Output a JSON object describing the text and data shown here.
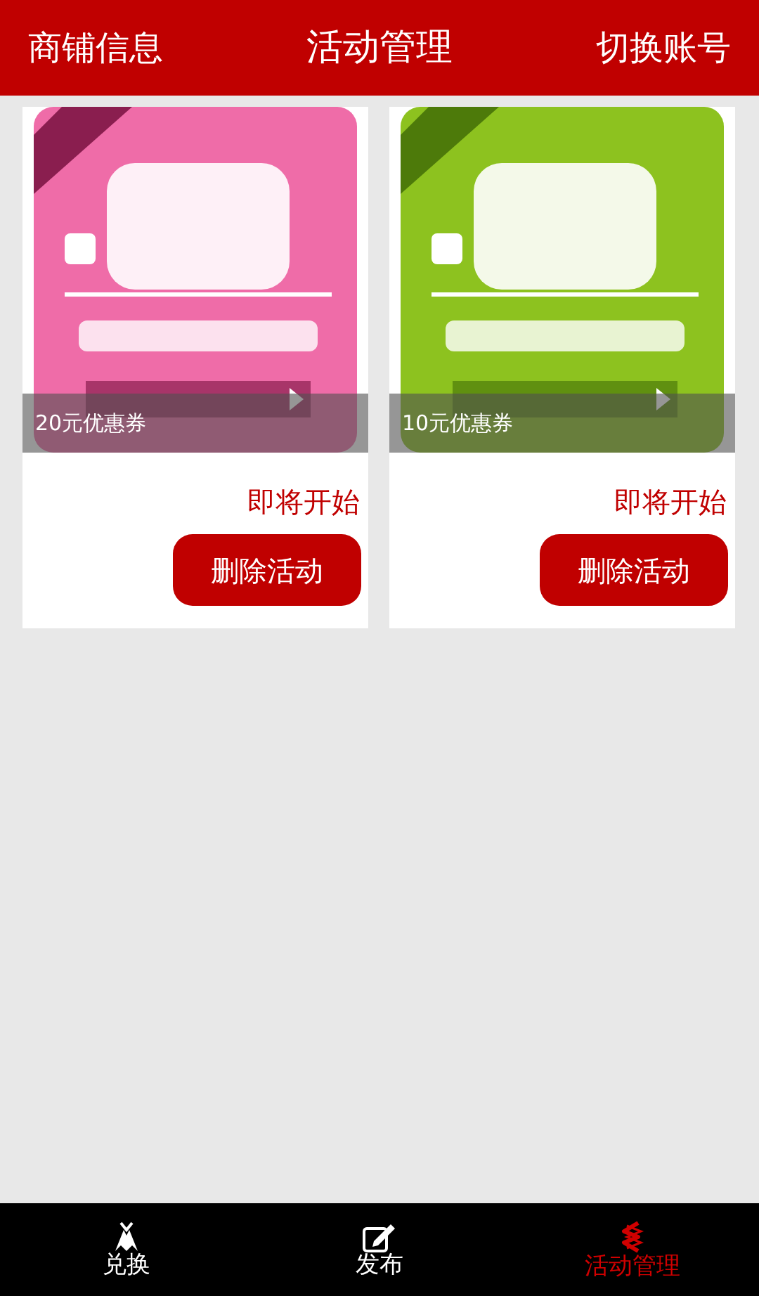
{
  "header": {
    "left": "商铺信息",
    "title": "活动管理",
    "right": "切换账号"
  },
  "activities": [
    {
      "caption": "20元优惠券",
      "status": "即将开始",
      "button": "删除活动"
    },
    {
      "caption": "10元优惠券",
      "status": "即将开始",
      "button": "删除活动"
    }
  ],
  "nav": [
    {
      "label": "兑换",
      "kind": "exchange",
      "selected": false
    },
    {
      "label": "发布",
      "kind": "publish",
      "selected": false
    },
    {
      "label": "活动管理",
      "kind": "activity",
      "selected": true
    }
  ]
}
